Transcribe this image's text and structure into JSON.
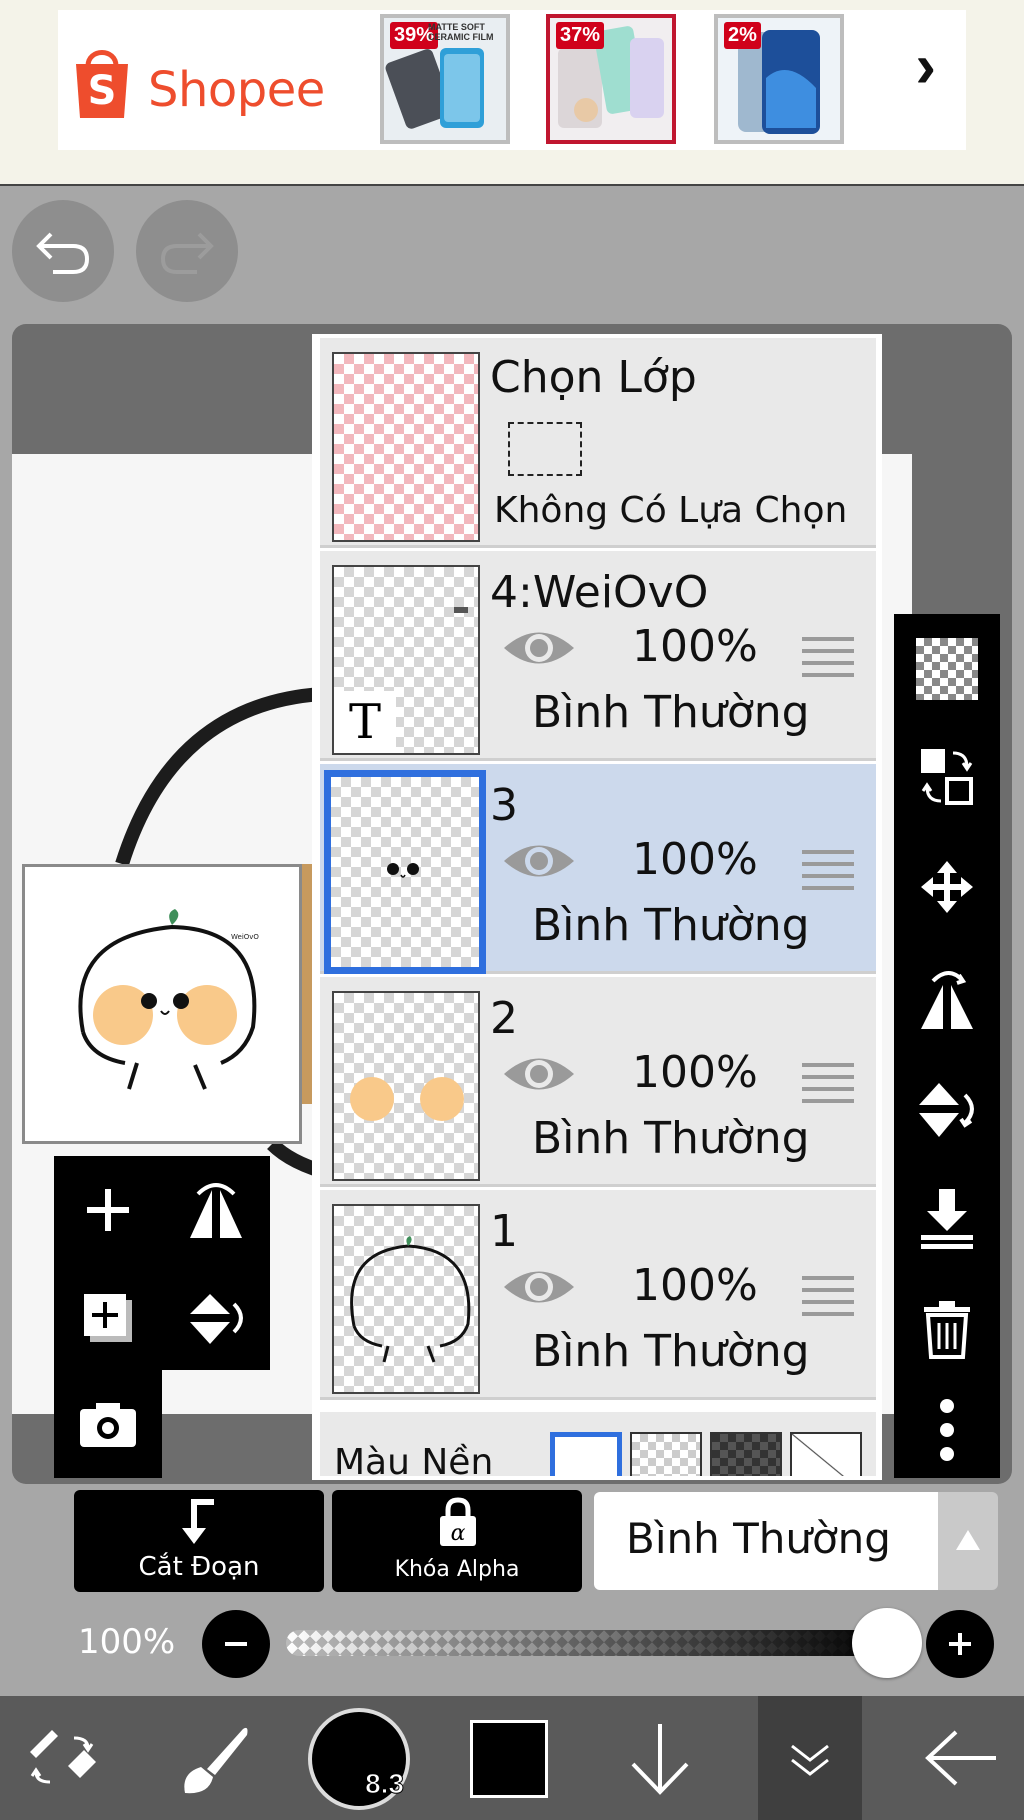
{
  "ad": {
    "brand": "Shopee",
    "products": [
      {
        "discount": "39%",
        "caption": "MATTE SOFT CERAMIC FILM"
      },
      {
        "discount": "37%",
        "caption": ""
      },
      {
        "discount": "2%",
        "caption": ""
      }
    ],
    "next_symbol": "›"
  },
  "layers": {
    "selection": {
      "title": "Chọn Lớp",
      "status": "Không Có Lựa Chọn"
    },
    "items": [
      {
        "name": "4:WeiOvO",
        "opacity": "100%",
        "mode": "Bình Thường"
      },
      {
        "name": "3",
        "opacity": "100%",
        "mode": "Bình Thường"
      },
      {
        "name": "2",
        "opacity": "100%",
        "mode": "Bình Thường"
      },
      {
        "name": "1",
        "opacity": "100%",
        "mode": "Bình Thường"
      }
    ],
    "background_label": "Màu Nền"
  },
  "options": {
    "clip_label": "Cắt Đoạn",
    "alpha_lock_label": "Khóa Alpha",
    "blend_mode": "Bình Thường"
  },
  "opacity": {
    "label": "100%",
    "value": 1.0
  },
  "brush": {
    "size": "8.3"
  },
  "colors": {
    "accent_blue": "#2f6fde",
    "shopee_orange": "#ee4d2d",
    "selected_row": "#ccd9ec"
  }
}
